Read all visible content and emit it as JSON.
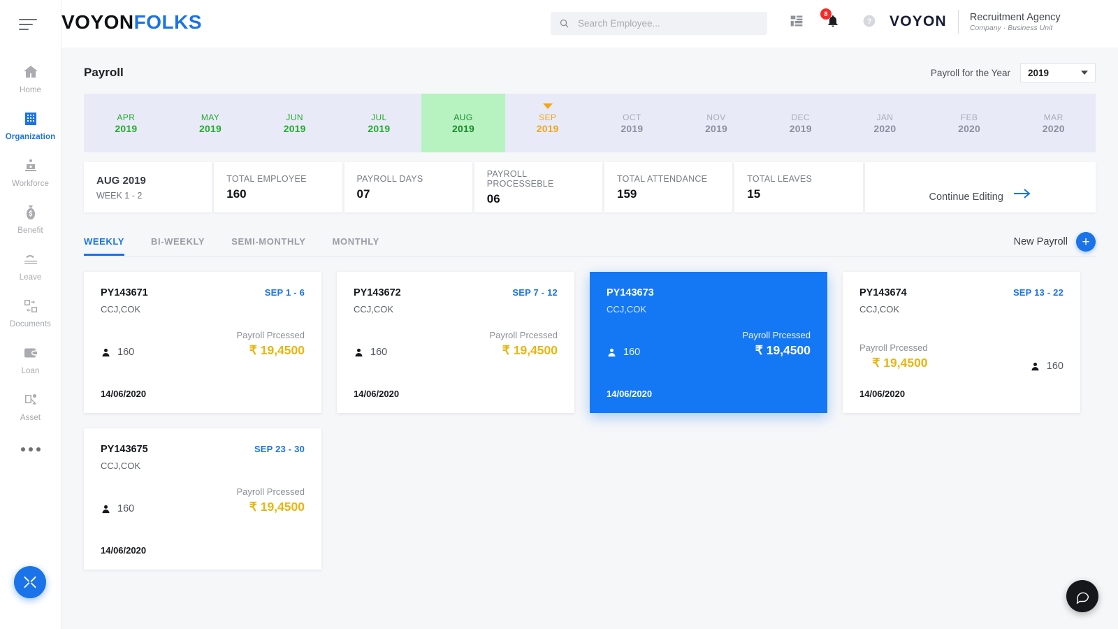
{
  "app": {
    "logo_dark": "VOYON",
    "logo_light": "FOLKS"
  },
  "search": {
    "placeholder": "Search Employee...",
    "value": "",
    "icon": "search-icon"
  },
  "topbar": {
    "apps_icon": "grid-apps-icon",
    "notifications_icon": "bell-icon",
    "notifications_count": "8",
    "help_icon": "help-circle-icon",
    "org_logo": "VOYON",
    "org_name": "Recruitment Agency",
    "org_sub": "Company · Business Unit",
    "avatar": "user-avatar"
  },
  "sidebar": {
    "menu_icon": "hamburger-icon",
    "more_icon": "more-dots-icon",
    "tools_icon": "tools-icon",
    "items": [
      {
        "label": "Home",
        "icon": "home-icon",
        "active": false
      },
      {
        "label": "Organization",
        "icon": "building-icon",
        "active": true
      },
      {
        "label": "Workforce",
        "icon": "workforce-icon",
        "active": false
      },
      {
        "label": "Benefit",
        "icon": "money-bag-icon",
        "active": false
      },
      {
        "label": "Leave",
        "icon": "leave-icon",
        "active": false
      },
      {
        "label": "Documents",
        "icon": "documents-icon",
        "active": false
      },
      {
        "label": "Loan",
        "icon": "wallet-icon",
        "active": false
      },
      {
        "label": "Asset",
        "icon": "asset-icon",
        "active": false
      }
    ]
  },
  "page": {
    "title": "Payroll",
    "year_label": "Payroll for the Year",
    "year_value": "2019",
    "year_caret": "chevron-down-icon"
  },
  "months": [
    {
      "name": "APR",
      "year": "2019",
      "state": "done"
    },
    {
      "name": "MAY",
      "year": "2019",
      "state": "done"
    },
    {
      "name": "JUN",
      "year": "2019",
      "state": "done"
    },
    {
      "name": "JUL",
      "year": "2019",
      "state": "done"
    },
    {
      "name": "AUG",
      "year": "2019",
      "state": "current"
    },
    {
      "name": "SEP",
      "year": "2019",
      "state": "upcoming"
    },
    {
      "name": "OCT",
      "year": "2019",
      "state": "future"
    },
    {
      "name": "NOV",
      "year": "2019",
      "state": "future"
    },
    {
      "name": "DEC",
      "year": "2019",
      "state": "future"
    },
    {
      "name": "JAN",
      "year": "2020",
      "state": "future"
    },
    {
      "name": "FEB",
      "year": "2020",
      "state": "future"
    },
    {
      "name": "MAR",
      "year": "2020",
      "state": "future"
    }
  ],
  "stats": {
    "period_title": "AUG 2019",
    "period_sub": "WEEK 1 -  2",
    "items": [
      {
        "label": "TOTAL EMPLOYEE",
        "value": "160"
      },
      {
        "label": "PAYROLL DAYS",
        "value": "07"
      },
      {
        "label": "PAYROLL PROCESSEBLE",
        "value": "06"
      },
      {
        "label": "TOTAL ATTENDANCE",
        "value": "159"
      },
      {
        "label": "TOTAL LEAVES",
        "value": "15"
      }
    ],
    "cta_label": "Continue Editing",
    "cta_icon": "arrow-right-icon"
  },
  "tabs": [
    {
      "label": "WEEKLY",
      "active": true
    },
    {
      "label": "BI-WEEKLY",
      "active": false
    },
    {
      "label": "SEMI-MONTHLY",
      "active": false
    },
    {
      "label": "MONTHLY",
      "active": false
    }
  ],
  "new_payroll": {
    "label": "New Payroll",
    "icon": "plus-icon"
  },
  "cards": [
    {
      "id": "PY143671",
      "range": "SEP 1 - 6",
      "location": "CCJ,COK",
      "employees": "160",
      "status": "Payroll Prcessed",
      "amount": "₹ 19,4500",
      "date": "14/06/2020",
      "selected": false
    },
    {
      "id": "PY143672",
      "range": "SEP 7 - 12",
      "location": "CCJ,COK",
      "employees": "160",
      "status": "Payroll Prcessed",
      "amount": "₹ 19,4500",
      "date": "14/06/2020",
      "selected": false
    },
    {
      "id": "PY143673",
      "range": "",
      "location": "CCJ,COK",
      "employees": "160",
      "status": "Payroll Prcessed",
      "amount": "₹ 19,4500",
      "date": "14/06/2020",
      "selected": true
    },
    {
      "id": "PY143674",
      "range": "SEP 13 - 22",
      "location": "CCJ,COK",
      "employees": "160",
      "status": "Payroll Prcessed",
      "amount": "₹ 19,4500",
      "date": "14/06/2020",
      "selected": false
    },
    {
      "id": "PY143675",
      "range": "SEP 23 - 30",
      "location": "CCJ,COK",
      "employees": "160",
      "status": "Payroll Prcessed",
      "amount": "₹ 19,4500",
      "date": "14/06/2020",
      "selected": false
    }
  ],
  "chat": {
    "icon": "chat-bubble-icon"
  },
  "colors": {
    "accent_blue": "#1a73e8",
    "card_selected": "#1478f5",
    "amount_gold": "#e9b510",
    "month_done_green": "#1fae2a",
    "month_current_bg": "#b6f3c0",
    "month_upcoming_orange": "#f0a719",
    "badge_red": "#f22c2c",
    "strip_bg": "#e9eaf8"
  }
}
